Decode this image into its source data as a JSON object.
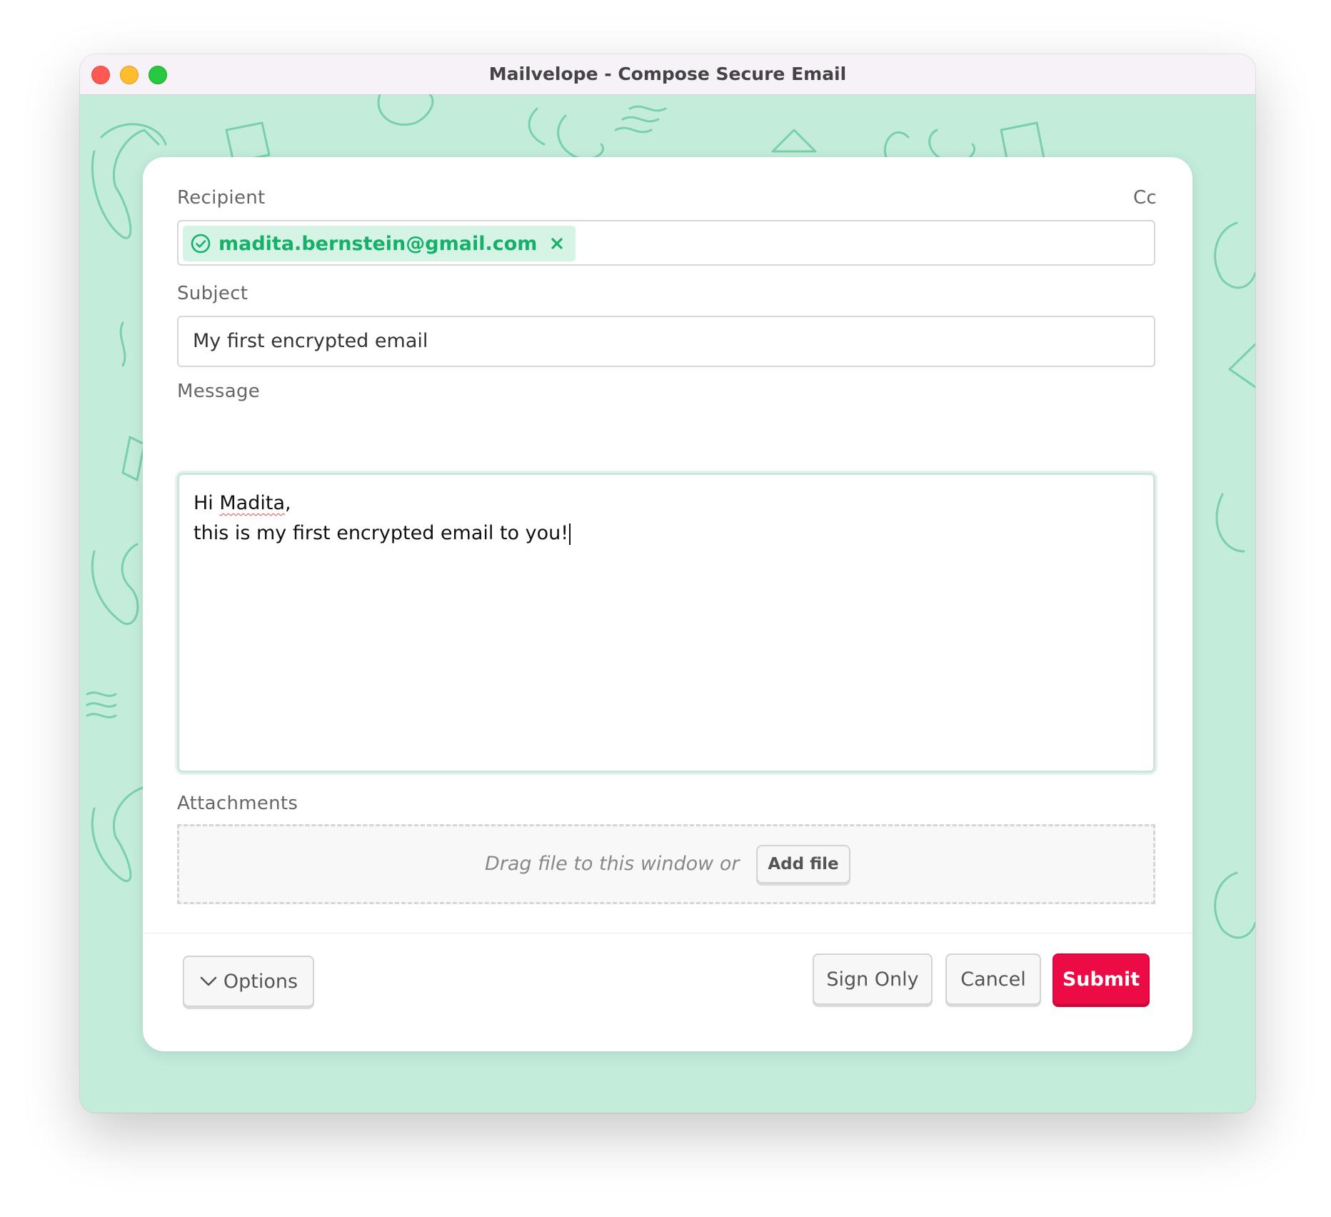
{
  "window": {
    "title": "Mailvelope - Compose Secure Email"
  },
  "form": {
    "recipient_label": "Recipient",
    "cc_label": "Cc",
    "recipient_chip": "madita.bernstein@gmail.com",
    "subject_label": "Subject",
    "subject_value": "My first encrypted email",
    "message_label": "Message",
    "message_greeting_prefix": "Hi ",
    "message_greeting_name": "Madita",
    "message_greeting_suffix": ",",
    "message_line2": "this is my first encrypted email to you!",
    "attachments_label": "Attachments",
    "drag_text": "Drag file to this window or",
    "add_file_label": "Add file"
  },
  "footer": {
    "options_label": "Options",
    "sign_only_label": "Sign Only",
    "cancel_label": "Cancel",
    "submit_label": "Submit"
  },
  "colors": {
    "background": "#c3ecdb",
    "pattern": "#79d0ab",
    "recipient_chip_bg": "#d5f4e6",
    "recipient_chip_text": "#16b06a",
    "submit": "#ec0b45"
  }
}
